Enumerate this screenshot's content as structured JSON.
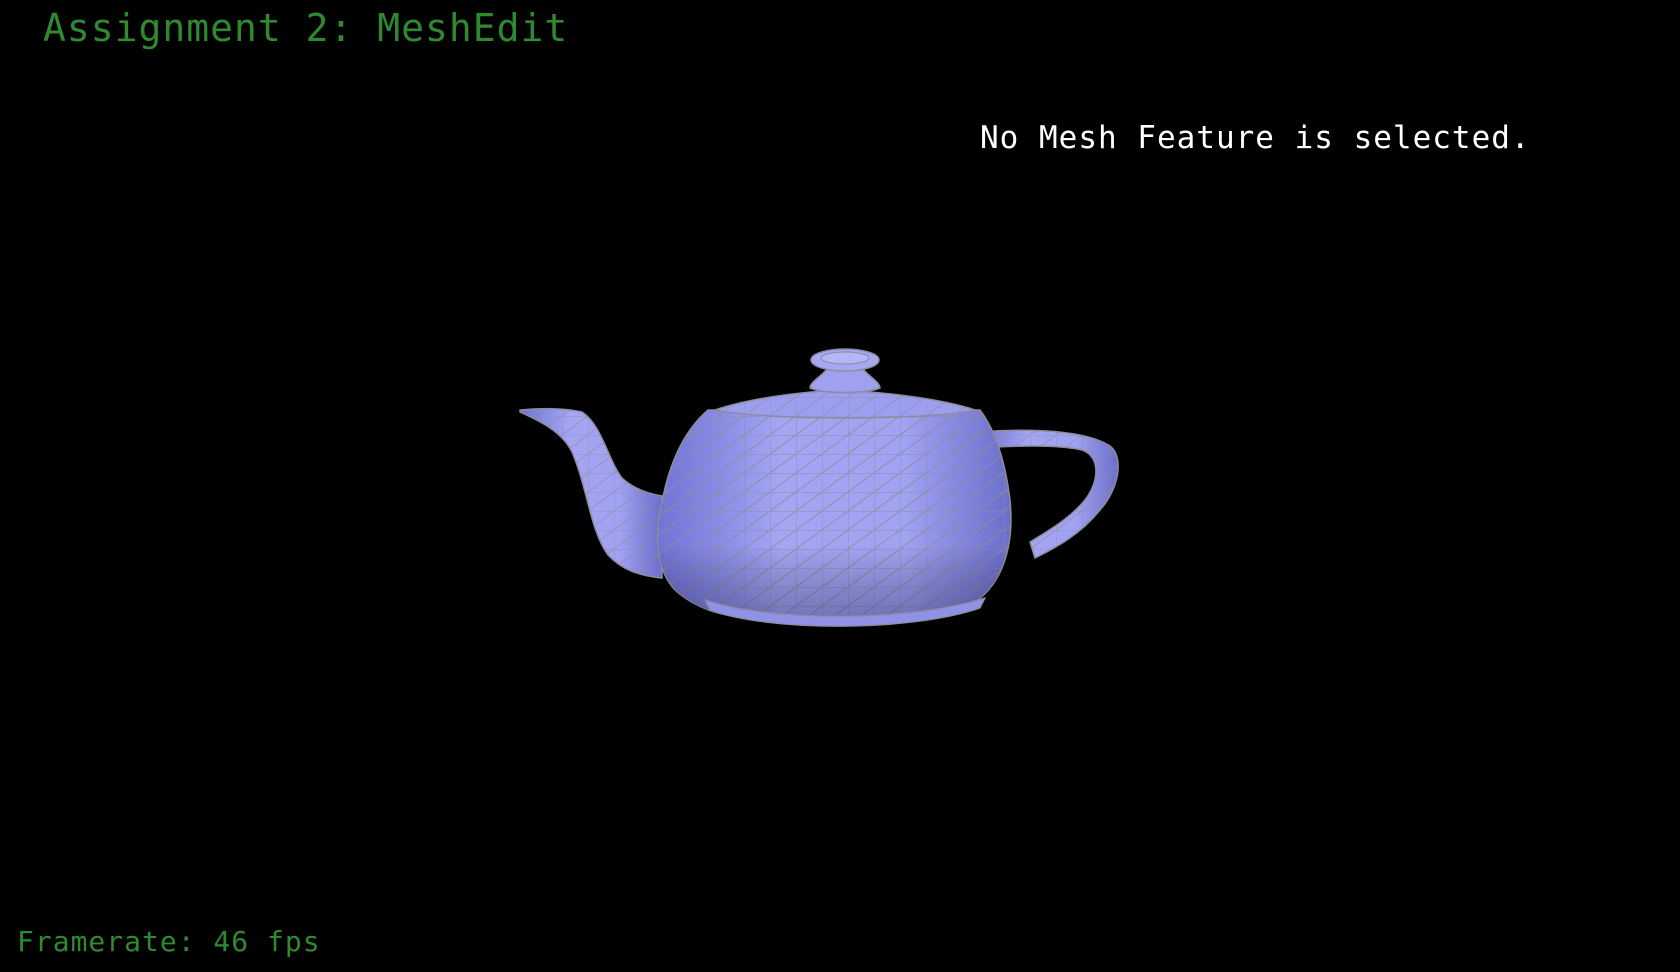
{
  "window": {
    "title": "Assignment 2: MeshEdit"
  },
  "status": {
    "selection_message": "No Mesh Feature is selected.",
    "framerate_label": "Framerate: 46 fps"
  },
  "scene": {
    "model_icon": "teapot-mesh",
    "background_color": "#000000",
    "mesh_fill_color": "#9a9cf0",
    "mesh_edge_color": "#8c8c9c",
    "hud_text_color": "#2f8a2f",
    "info_text_color": "#ffffff"
  }
}
